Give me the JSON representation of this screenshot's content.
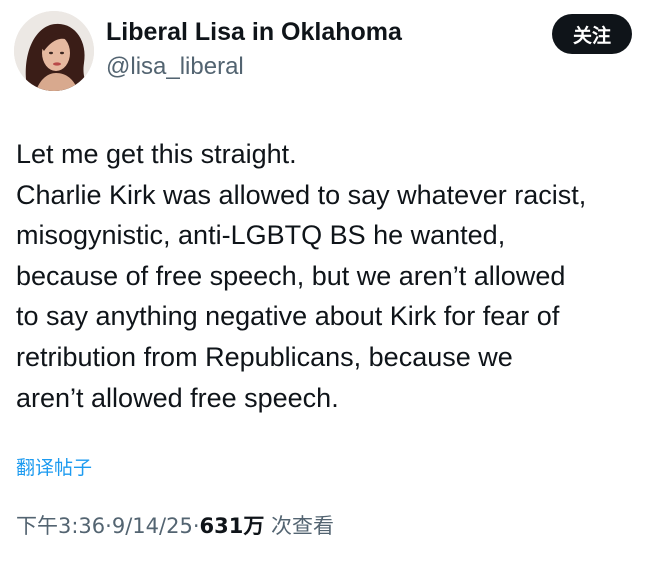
{
  "author": {
    "display_name": "Liberal Lisa in Oklahoma",
    "handle": "@lisa_liberal",
    "avatar_icon": "profile-photo"
  },
  "follow_button": {
    "label": "关注"
  },
  "post": {
    "lines": [
      "Let me get this straight.",
      "Charlie Kirk was allowed to say whatever racist,",
      "misogynistic, anti-LGBTQ BS he wanted,",
      "because of free speech, but we aren’t allowed",
      "to say anything negative about Kirk for fear of",
      "retribution from Republicans, because we",
      "aren’t allowed free speech."
    ]
  },
  "translate": {
    "label": "翻译帖子"
  },
  "meta": {
    "time": "下午3:36",
    "separator": "·",
    "date": "9/14/25",
    "views_count": "631万",
    "views_label": "次查看"
  },
  "colors": {
    "text": "#0f1419",
    "secondary": "#536471",
    "link": "#1d9bf0",
    "button_bg": "#0f1419",
    "button_text": "#ffffff"
  }
}
